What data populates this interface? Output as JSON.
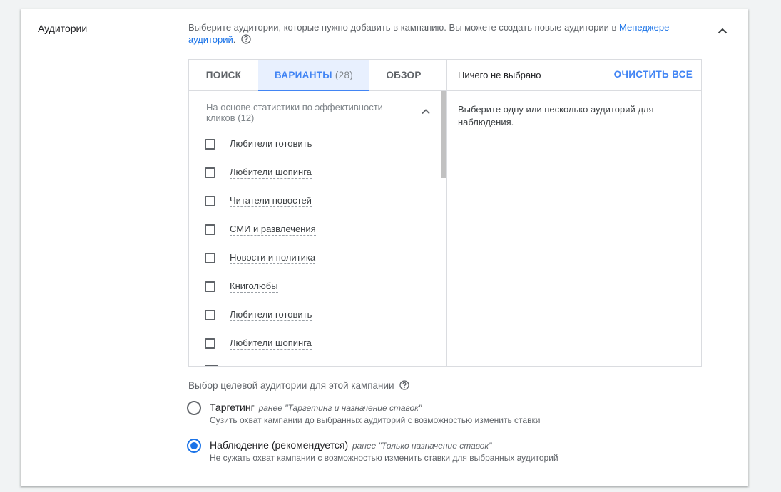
{
  "section": {
    "title": "Аудитории",
    "description_prefix": "Выберите аудитории, которые нужно добавить в кампанию. Вы можете создать новые аудитории в ",
    "description_link": "Менеджере аудиторий",
    "description_suffix": "."
  },
  "tabs": [
    {
      "label": "ПОИСК",
      "count": ""
    },
    {
      "label": "ВАРИАНТЫ",
      "count": "(28)"
    },
    {
      "label": "ОБЗОР",
      "count": ""
    }
  ],
  "active_tab": "ВАРИАНТЫ",
  "group": {
    "header": "На основе статистики по эффективности кликов (12)",
    "items": [
      {
        "label": "Любители готовить"
      },
      {
        "label": "Любители шопинга"
      },
      {
        "label": "Читатели новостей"
      },
      {
        "label": "СМИ и развлечения"
      },
      {
        "label": "Новости и политика"
      },
      {
        "label": "Книголюбы"
      },
      {
        "label": "Любители готовить"
      },
      {
        "label": "Любители шопинга"
      }
    ]
  },
  "selection": {
    "empty_label": "Ничего не выбрано",
    "clear_all": "ОЧИСТИТЬ ВСЕ",
    "hint": "Выберите одну или несколько аудиторий для наблюдения."
  },
  "targeting": {
    "label": "Выбор целевой аудитории для этой кампании",
    "options": [
      {
        "title": "Таргетинг",
        "former": "ранее \"Таргетинг и назначение ставок\"",
        "subtitle": "Сузить охват кампании до выбранных аудиторий с возможностью изменить ставки",
        "checked": false
      },
      {
        "title": "Наблюдение (рекомендуется)",
        "former": "ранее \"Только назначение ставок\"",
        "subtitle": "Не сужать охват кампании с возможностью изменить ставки для выбранных аудиторий",
        "checked": true
      }
    ]
  },
  "colors": {
    "accent": "#4285f4",
    "link": "#1a73e8"
  }
}
